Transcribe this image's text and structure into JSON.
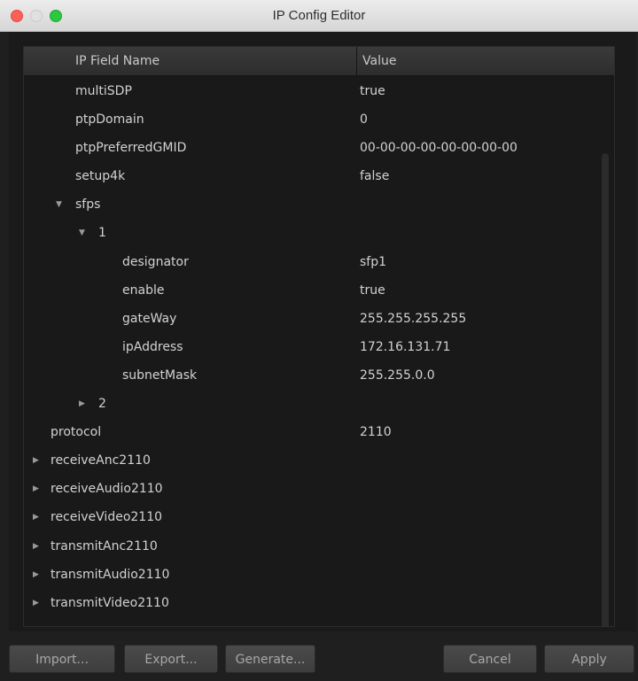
{
  "window": {
    "title": "IP Config Editor"
  },
  "columns": {
    "name": "IP Field Name",
    "value": "Value"
  },
  "rows": [
    {
      "toggle": "",
      "label": "multiSDP",
      "value": "true"
    },
    {
      "toggle": "",
      "label": "ptpDomain",
      "value": "0"
    },
    {
      "toggle": "",
      "label": "ptpPreferredGMID",
      "value": "00-00-00-00-00-00-00-00"
    },
    {
      "toggle": "",
      "label": "setup4k",
      "value": "false"
    },
    {
      "toggle": "▼",
      "label": "sfps",
      "value": ""
    },
    {
      "toggle": "▼",
      "label": "1",
      "value": ""
    },
    {
      "toggle": "",
      "label": "designator",
      "value": "sfp1"
    },
    {
      "toggle": "",
      "label": "enable",
      "value": "true"
    },
    {
      "toggle": "",
      "label": "gateWay",
      "value": "255.255.255.255"
    },
    {
      "toggle": "",
      "label": "ipAddress",
      "value": "172.16.131.71"
    },
    {
      "toggle": "",
      "label": "subnetMask",
      "value": "255.255.0.0"
    },
    {
      "toggle": "▶",
      "label": "2",
      "value": ""
    },
    {
      "toggle": "",
      "label": "protocol",
      "value": "2110"
    },
    {
      "toggle": "▶",
      "label": "receiveAnc2110",
      "value": ""
    },
    {
      "toggle": "▶",
      "label": "receiveAudio2110",
      "value": ""
    },
    {
      "toggle": "▶",
      "label": "receiveVideo2110",
      "value": ""
    },
    {
      "toggle": "▶",
      "label": "transmitAnc2110",
      "value": ""
    },
    {
      "toggle": "▶",
      "label": "transmitAudio2110",
      "value": ""
    },
    {
      "toggle": "▶",
      "label": "transmitVideo2110",
      "value": ""
    }
  ],
  "buttons": {
    "import": "Import...",
    "export": "Export...",
    "generate": "Generate...",
    "cancel": "Cancel",
    "apply": "Apply"
  }
}
